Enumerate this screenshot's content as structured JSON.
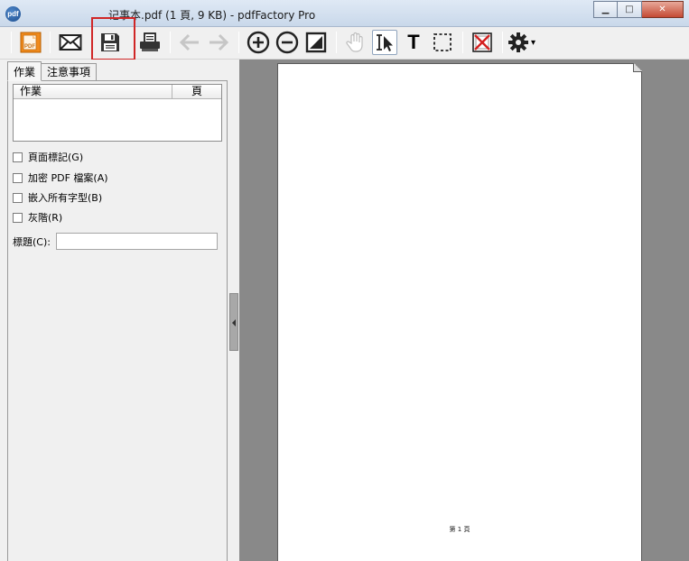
{
  "window": {
    "app_icon_text": "pdf",
    "title": "记事本.pdf (1 頁, 9 KB) - pdfFactory Pro",
    "minimize": "▁",
    "maximize": "□",
    "close": "✕"
  },
  "toolbar": {
    "items": [
      {
        "name": "pdf-file-icon",
        "state": "enabled"
      },
      {
        "name": "email-icon",
        "state": "enabled"
      },
      {
        "name": "save-icon",
        "state": "highlighted"
      },
      {
        "name": "print-icon",
        "state": "enabled"
      },
      {
        "name": "arrow-left-icon",
        "state": "disabled"
      },
      {
        "name": "arrow-right-icon",
        "state": "disabled"
      },
      {
        "name": "zoom-in-icon",
        "state": "enabled"
      },
      {
        "name": "zoom-out-icon",
        "state": "enabled"
      },
      {
        "name": "fit-page-icon",
        "state": "enabled"
      },
      {
        "name": "hand-tool-icon",
        "state": "disabled"
      },
      {
        "name": "text-select-icon",
        "state": "active"
      },
      {
        "name": "text-tool-icon",
        "state": "enabled"
      },
      {
        "name": "marquee-select-icon",
        "state": "enabled"
      },
      {
        "name": "delete-page-icon",
        "state": "enabled"
      },
      {
        "name": "settings-gear-icon",
        "state": "enabled"
      }
    ],
    "text_tool_glyph": "T",
    "dropdown_glyph": "▾"
  },
  "left_panel": {
    "tabs": [
      {
        "label": "作業",
        "active": true
      },
      {
        "label": "注意事項",
        "active": false
      }
    ],
    "jobs_table": {
      "columns": [
        "作業",
        "頁"
      ],
      "rows": []
    },
    "checkboxes": [
      {
        "label": "頁面標記(G)",
        "checked": false
      },
      {
        "label": "加密 PDF 檔案(A)",
        "checked": false
      },
      {
        "label": "嵌入所有字型(B)",
        "checked": false
      },
      {
        "label": "灰階(R)",
        "checked": false
      }
    ],
    "title_field": {
      "label": "標題(C):",
      "value": ""
    }
  },
  "preview": {
    "page_footer": "第 1 頁"
  },
  "colors": {
    "highlight_border": "#d02626",
    "preview_background": "#898989",
    "pdf_icon_orange": "#f08a1c"
  }
}
